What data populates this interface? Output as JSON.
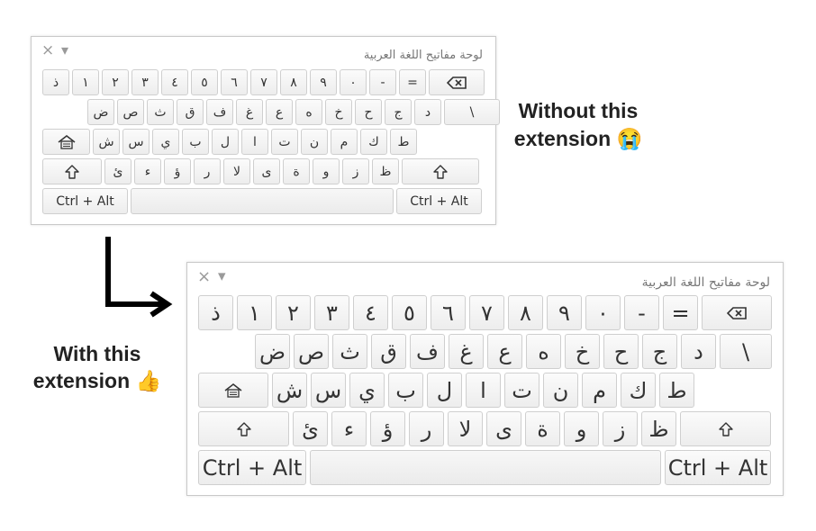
{
  "captions": {
    "without": "Without this extension 😭",
    "with": "With this extension 👍"
  },
  "keyboard": {
    "title": "لوحة مفاتيح اللغة العربية",
    "close_glyph": "×",
    "menu_glyph": "▾",
    "rows": [
      [
        "ذ",
        "١",
        "٢",
        "٣",
        "٤",
        "٥",
        "٦",
        "٧",
        "٨",
        "٩",
        "٠",
        "-",
        "=",
        "backspace"
      ],
      [
        "ض",
        "ص",
        "ث",
        "ق",
        "ف",
        "غ",
        "ع",
        "ه",
        "خ",
        "ح",
        "ج",
        "د",
        "\\"
      ],
      [
        "home",
        "ش",
        "س",
        "ي",
        "ب",
        "ل",
        "ا",
        "ت",
        "ن",
        "م",
        "ك",
        "ط"
      ],
      [
        "shift",
        "ئ",
        "ء",
        "ؤ",
        "ر",
        "لا",
        "ى",
        "ة",
        "و",
        "ز",
        "ظ",
        "shift"
      ],
      [
        "Ctrl + Alt",
        "space",
        "Ctrl + Alt"
      ]
    ]
  },
  "colors": {
    "key_border": "#cfcfcf",
    "panel_border": "#c9c9c9",
    "text": "#333333"
  },
  "icons": {
    "backspace": "backspace-icon",
    "home": "home-icon",
    "shift": "shift-icon",
    "close": "close-icon",
    "menu": "menu-triangle-icon"
  }
}
